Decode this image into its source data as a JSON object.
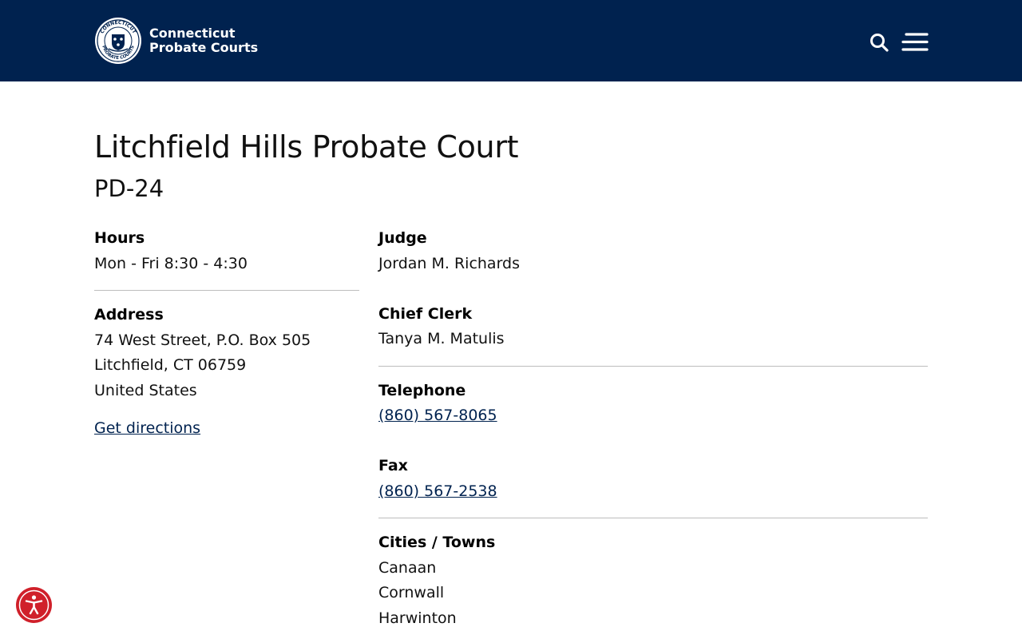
{
  "header": {
    "brand_line1": "Connecticut",
    "brand_line2": "Probate Courts",
    "seal_text_top": "CONNECTICUT",
    "seal_text_bottom": "PROBATE COURTS",
    "search_icon": "search-icon",
    "menu_icon": "hamburger-menu-icon"
  },
  "page": {
    "title": "Litchfield Hills Probate Court",
    "subtitle": "PD-24"
  },
  "left": {
    "hours_label": "Hours",
    "hours_value": "Mon - Fri 8:30 - 4:30",
    "address_label": "Address",
    "address_lines": [
      "74 West Street, P.O. Box 505",
      "Litchfield, CT 06759",
      "United States"
    ],
    "directions_link": "Get directions"
  },
  "right": {
    "judge_label": "Judge",
    "judge_value": "Jordan M. Richards",
    "clerk_label": "Chief Clerk",
    "clerk_value": "Tanya M. Matulis",
    "telephone_label": "Telephone",
    "telephone_value": "(860) 567-8065",
    "fax_label": "Fax",
    "fax_value": "(860) 567-2538",
    "towns_label": "Cities / Towns",
    "towns": [
      "Canaan",
      "Cornwall",
      "Harwinton"
    ]
  },
  "colors": {
    "header_bg": "#00224f",
    "link": "#00224f",
    "accessibility_button": "#d0202a"
  },
  "accessibility": {
    "icon": "accessibility-icon"
  }
}
